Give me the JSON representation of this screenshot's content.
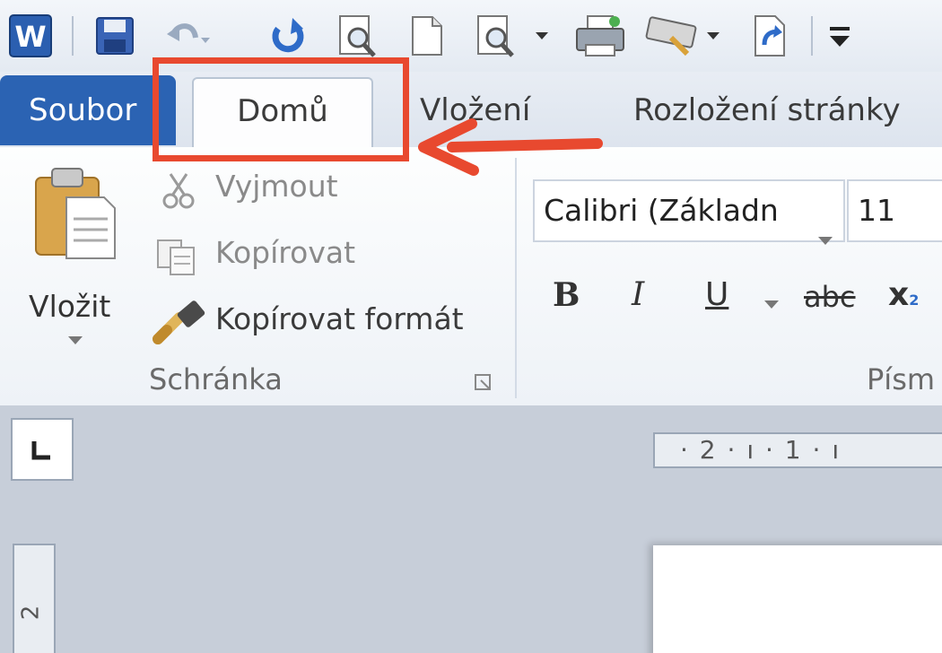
{
  "ribbon_tabs": {
    "file": "Soubor",
    "home": "Domů",
    "insert": "Vložení",
    "layout": "Rozložení stránky"
  },
  "clipboard": {
    "paste": "Vložit",
    "cut": "Vyjmout",
    "copy": "Kopírovat",
    "format_painter": "Kopírovat formát",
    "group_label": "Schránka"
  },
  "font": {
    "name": "Calibri (Základn",
    "size": "11",
    "bold": "B",
    "italic": "I",
    "underline": "U",
    "strikethrough": "abc",
    "subscript": "x",
    "subscript_small": "2",
    "group_label": "Písm"
  },
  "ruler": {
    "horizontal": "· 2 · ı · 1 · ı",
    "vertical": "2"
  },
  "colors": {
    "file_tab": "#2b63b3",
    "annotation": "#e8492f"
  },
  "icons": [
    "word-app-icon",
    "save-icon",
    "undo-icon",
    "redo-icon",
    "print-preview-icon",
    "new-document-icon",
    "quick-print-icon",
    "printer-icon",
    "keyboard-icon",
    "document-arrow-icon",
    "customize-toolbar-icon",
    "paste-icon",
    "scissors-icon",
    "copy-icon",
    "format-painter-icon"
  ]
}
